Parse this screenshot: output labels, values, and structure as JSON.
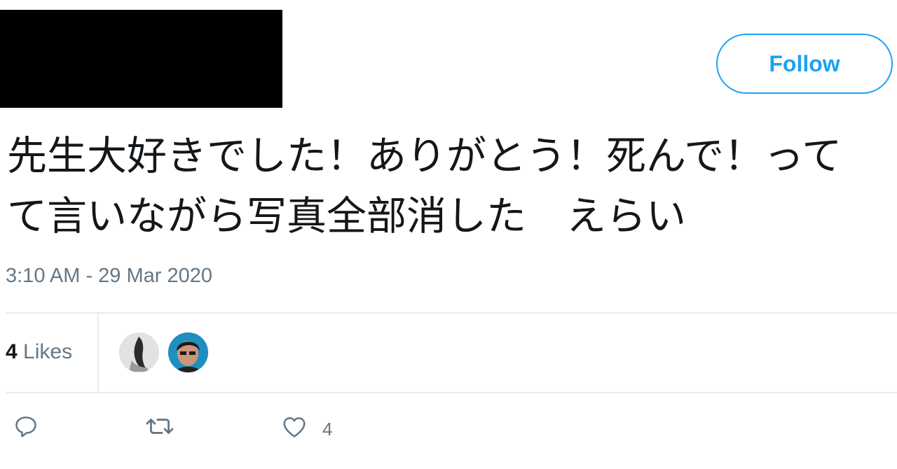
{
  "header": {
    "follow_label": "Follow"
  },
  "tweet": {
    "text": "先生大好きでした！ありがとう！死んで！って\nて言いながら写真全部消した　えらい",
    "timestamp": "3:10 AM - 29 Mar 2020"
  },
  "stats": {
    "likes_number": "4",
    "likes_label": "Likes"
  },
  "actions": {
    "like_count": "4"
  },
  "colors": {
    "accent": "#1da1f2",
    "secondary_text": "#657786",
    "divider": "#e6ecf0"
  },
  "icons": {
    "reply": "speech-bubble-icon",
    "retweet": "retweet-icon",
    "like": "heart-icon"
  }
}
